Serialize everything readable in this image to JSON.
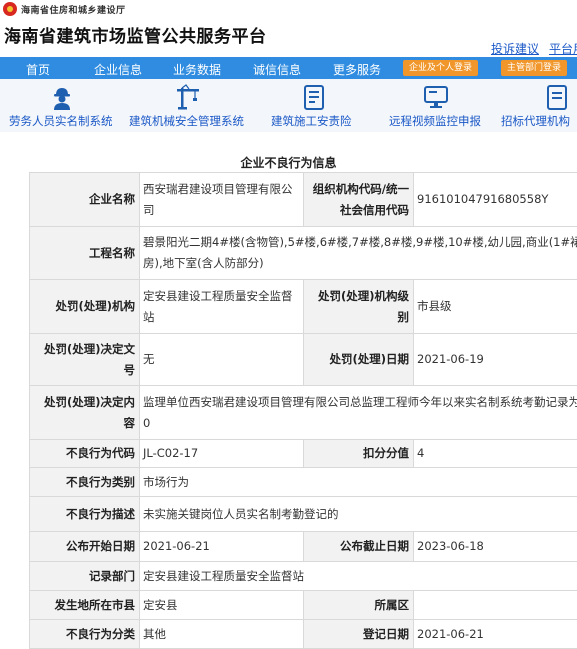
{
  "header": {
    "department": "海南省住房和城乡建设厅",
    "site_title": "海南省建筑市场监管公共服务平台",
    "links": [
      "投诉建议",
      "平台用"
    ]
  },
  "nav": {
    "items": [
      "首页",
      "企业信息",
      "业务数据",
      "诚信信息",
      "更多服务"
    ],
    "buttons": [
      "企业及个人登录",
      "主管部门登录"
    ]
  },
  "quick_links": [
    {
      "label": "劳务人员实名制系统",
      "icon": "worker-icon"
    },
    {
      "label": "建筑机械安全管理系统",
      "icon": "crane-icon"
    },
    {
      "label": "建筑施工安责险",
      "icon": "insurance-icon"
    },
    {
      "label": "远程视频监控申报",
      "icon": "monitor-icon"
    },
    {
      "label": "招标代理机构",
      "icon": "document-icon"
    }
  ],
  "record": {
    "title": "企业不良行为信息",
    "labels": {
      "company": "企业名称",
      "org_code": "组织机构代码/统一社会信用代码",
      "project": "工程名称",
      "penalty_org": "处罚(处理)机构",
      "penalty_level": "处罚(处理)机构级别",
      "decision_no": "处罚(处理)决定文号",
      "penalty_date": "处罚(处理)日期",
      "decision_content": "处罚(处理)决定内容",
      "behavior_code": "不良行为代码",
      "score": "扣分分值",
      "behavior_type": "不良行为类别",
      "behavior_desc": "不良行为描述",
      "publish_start": "公布开始日期",
      "publish_end": "公布截止日期",
      "record_dept": "记录部门",
      "city": "发生地所在市县",
      "district": "所属区",
      "category": "不良行为分类",
      "register_date": "登记日期"
    },
    "values": {
      "company": "西安瑞君建设项目管理有限公司",
      "org_code": "91610104791680558Y",
      "project": "碧景阳光二期4#楼(含物管),5#楼,6#楼,7#楼,8#楼,9#楼,10#楼,幼儿园,商业(1#裙房),地下室(含人防部分)",
      "penalty_org": "定安县建设工程质量安全监督站",
      "penalty_level": "市县级",
      "decision_no": "无",
      "penalty_date": "2021-06-19",
      "decision_content": "监理单位西安瑞君建设项目管理有限公司总监理工程师今年以来实名制系统考勤记录为0",
      "behavior_code": "JL-C02-17",
      "score": "4",
      "behavior_type": "市场行为",
      "behavior_desc": "未实施关键岗位人员实名制考勤登记的",
      "publish_start": "2021-06-21",
      "publish_end": "2023-06-18",
      "record_dept": "定安县建设工程质量安全监督站",
      "city": "定安县",
      "district": "",
      "category": "其他",
      "register_date": "2021-06-21"
    }
  }
}
